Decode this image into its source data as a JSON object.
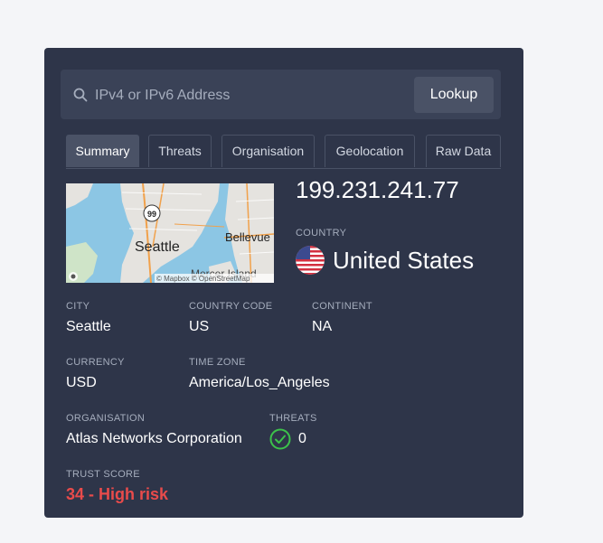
{
  "search": {
    "placeholder": "IPv4 or IPv6 Address",
    "value": "",
    "button_label": "Lookup"
  },
  "tabs": [
    {
      "label": "Summary",
      "active": true
    },
    {
      "label": "Threats",
      "active": false
    },
    {
      "label": "Organisation",
      "active": false
    },
    {
      "label": "Geolocation",
      "active": false
    },
    {
      "label": "Raw Data",
      "active": false
    }
  ],
  "map": {
    "city_label": "Seattle",
    "labels": [
      "Bellevue",
      "Mercer Island",
      "99"
    ],
    "attribution": "© Mapbox © OpenStreetMap"
  },
  "summary": {
    "ip": "199.231.241.77",
    "country_label": "COUNTRY",
    "country": "United States",
    "country_flag": "us-flag",
    "city_label": "CITY",
    "city": "Seattle",
    "country_code_label": "COUNTRY CODE",
    "country_code": "US",
    "continent_label": "CONTINENT",
    "continent": "NA",
    "currency_label": "CURRENCY",
    "currency": "USD",
    "timezone_label": "TIME ZONE",
    "timezone": "America/Los_Angeles",
    "organisation_label": "ORGANISATION",
    "organisation": "Atlas Networks Corporation",
    "threats_label": "THREATS",
    "threats": "0",
    "trust_label": "TRUST SCORE",
    "trust_score": "34 - High risk"
  },
  "colors": {
    "card_bg": "#2e3549",
    "risk_red": "#e94b4b",
    "ok_green": "#3cc24a"
  }
}
